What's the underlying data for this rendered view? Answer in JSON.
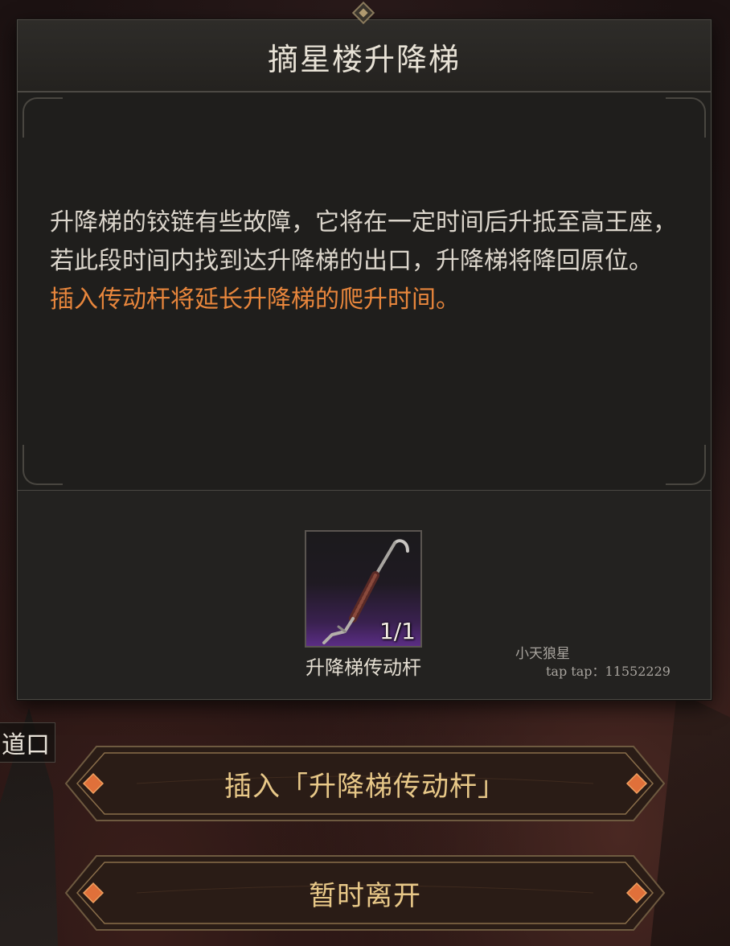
{
  "dialog": {
    "title": "摘星楼升降梯",
    "description": "升降梯的铰链有些故障，它将在一定时间后升抵至高王座，若此段时间内找到达升降梯的出口，升降梯将降回原位。",
    "highlight": "插入传动杆将延长升降梯的爬升时间。"
  },
  "item": {
    "icon": "crank-rod-icon",
    "count": "1/1",
    "name": "升降梯传动杆"
  },
  "watermark": {
    "line1": "小天狼星",
    "line2": "tap tap：11552229"
  },
  "side_label": "道口",
  "buttons": {
    "insert_label": "插入「升降梯传动杆」",
    "leave_label": "暂时离开"
  },
  "colors": {
    "highlight_text": "#e8863c",
    "button_text": "#e8c888",
    "gem": "#e0703a"
  }
}
